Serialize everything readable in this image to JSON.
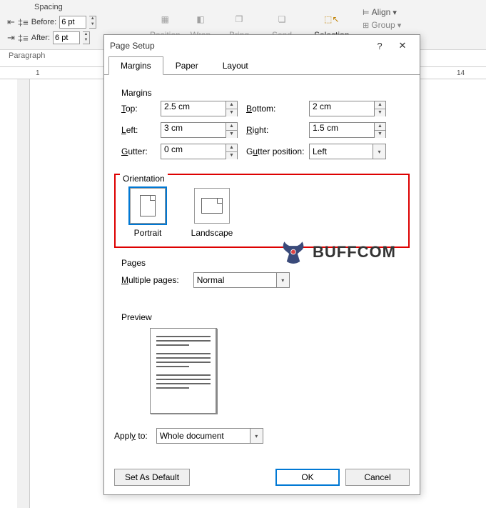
{
  "ribbon": {
    "spacing_label": "Spacing",
    "before_label": "Before:",
    "after_label": "After:",
    "before_value": "6 pt",
    "after_value": "6 pt",
    "paragraph_label": "Paragraph",
    "position": "Position",
    "wrap": "Wrap",
    "bring": "Bring",
    "send": "Send",
    "selection": "Selection",
    "align": "Align",
    "group": "Group"
  },
  "ruler": {
    "left": "1",
    "right": "14"
  },
  "dialog": {
    "title": "Page Setup",
    "help": "?",
    "close": "✕",
    "tabs": {
      "margins": "Margins",
      "paper": "Paper",
      "layout": "Layout"
    },
    "margins": {
      "title": "Margins",
      "top_label": "Top:",
      "top_value": "2.5 cm",
      "bottom_label": "Bottom:",
      "bottom_value": "2 cm",
      "left_label": "Left:",
      "left_value": "3 cm",
      "right_label": "Right:",
      "right_value": "1.5 cm",
      "gutter_label": "Gutter:",
      "gutter_value": "0 cm",
      "gutter_pos_label": "Gutter position:",
      "gutter_pos_value": "Left"
    },
    "orientation": {
      "title": "Orientation",
      "portrait": "Portrait",
      "landscape": "Landscape"
    },
    "pages": {
      "title": "Pages",
      "multiple_label": "Multiple pages:",
      "multiple_value": "Normal"
    },
    "preview_title": "Preview",
    "apply_label": "Apply to:",
    "apply_value": "Whole document",
    "set_default": "Set As Default",
    "ok": "OK",
    "cancel": "Cancel"
  },
  "watermark": "BUFFCOM"
}
